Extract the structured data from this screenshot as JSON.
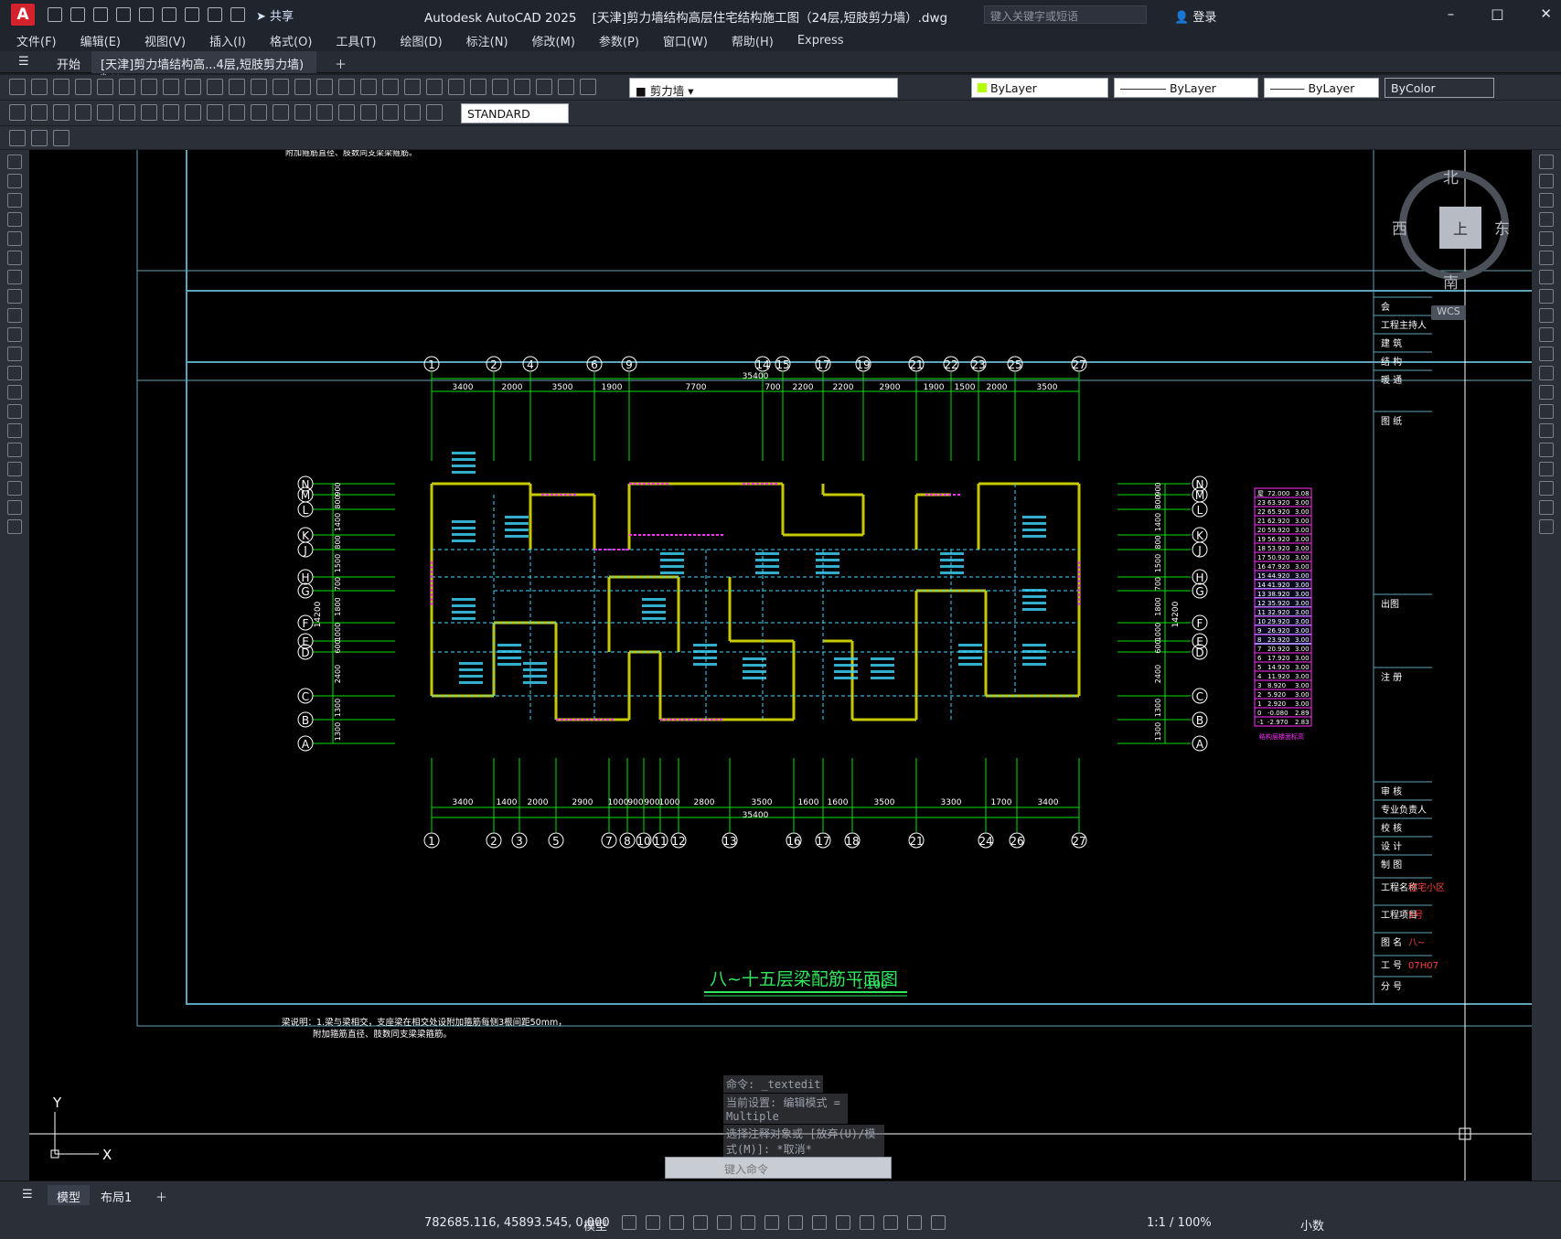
{
  "app": {
    "title": "Autodesk AutoCAD 2025",
    "document": "[天津]剪力墙结构高层住宅结构施工图（24层,短肢剪力墙）.dwg",
    "search_placeholder": "键入关键字或短语",
    "login": "登录",
    "share": "共享",
    "logo": "A"
  },
  "menu": [
    "文件(F)",
    "编辑(E)",
    "视图(V)",
    "插入(I)",
    "格式(O)",
    "工具(T)",
    "绘图(D)",
    "标注(N)",
    "修改(M)",
    "参数(P)",
    "窗口(W)",
    "帮助(H)",
    "Express"
  ],
  "tabs": {
    "start": "开始",
    "active": "[天津]剪力墙结构高...4层,短肢剪力墙)",
    "active_mark": "*"
  },
  "toolbar": {
    "layer": "剪力墙",
    "color": "ByLayer",
    "linetype": "ByLayer",
    "lineweight": "ByLayer",
    "plotstyle": "ByColor",
    "textstyle": "STANDARD"
  },
  "navcube": {
    "north": "北",
    "south": "南",
    "east": "东",
    "west": "西",
    "top": "上",
    "wcs": "WCS"
  },
  "drawing": {
    "top_note": "附加箍筋直径、肢数同支梁梁箍筋。",
    "plan_title": "八~十五层梁配筋平面图",
    "scale": "1:100",
    "notes_line1": "梁说明：1.梁与梁相交，支座梁在相交处设附加箍筋每侧3根间距50mm，",
    "notes_line2": "附加箍筋直径、肢数同支梁梁箍筋。",
    "top_axes": [
      "1",
      "2",
      "4",
      "6",
      "9",
      "14",
      "15",
      "17",
      "19",
      "21",
      "22",
      "23",
      "25",
      "27"
    ],
    "bottom_axes": [
      "1",
      "2",
      "3",
      "5",
      "7",
      "8",
      "10",
      "11",
      "12",
      "13",
      "16",
      "17",
      "18",
      "21",
      "24",
      "26",
      "27"
    ],
    "side_axes": [
      "N",
      "M",
      "L",
      "K",
      "J",
      "H",
      "G",
      "F",
      "E",
      "D",
      "C",
      "B",
      "A"
    ],
    "top_dims": [
      "3400",
      "2000",
      "3500",
      "1900",
      "7700",
      "700",
      "2200",
      "2200",
      "2900",
      "1900",
      "1500",
      "2000",
      "3500"
    ],
    "bottom_dims": [
      "3400",
      "1400",
      "2000",
      "2900",
      "1000",
      "900",
      "900",
      "1000",
      "2800",
      "3500",
      "1600",
      "1600",
      "3500",
      "3300",
      "1700",
      "3400"
    ],
    "total_dim": "35400",
    "side_dims": [
      "900",
      "800",
      "1400",
      "800",
      "1500",
      "700",
      "1800",
      "1000",
      "600",
      "2400",
      "1300",
      "1300"
    ],
    "side_total": "14200",
    "floor_table": [
      [
        "屋",
        "72.000",
        "3.08"
      ],
      [
        "23",
        "63.920",
        "3.00"
      ],
      [
        "22",
        "65.920",
        "3.00"
      ],
      [
        "21",
        "62.920",
        "3.00"
      ],
      [
        "20",
        "59.920",
        "3.00"
      ],
      [
        "19",
        "56.920",
        "3.00"
      ],
      [
        "18",
        "53.920",
        "3.00"
      ],
      [
        "17",
        "50.920",
        "3.00"
      ],
      [
        "16",
        "47.920",
        "3.00"
      ],
      [
        "15",
        "44.920",
        "3.00"
      ],
      [
        "14",
        "41.920",
        "3.00"
      ],
      [
        "13",
        "38.920",
        "3.00"
      ],
      [
        "12",
        "35.920",
        "3.00"
      ],
      [
        "11",
        "32.920",
        "3.00"
      ],
      [
        "10",
        "29.920",
        "3.00"
      ],
      [
        "9",
        "26.920",
        "3.00"
      ],
      [
        "8",
        "23.920",
        "3.00"
      ],
      [
        "7",
        "20.920",
        "3.00"
      ],
      [
        "6",
        "17.920",
        "3.00"
      ],
      [
        "5",
        "14.920",
        "3.00"
      ],
      [
        "4",
        "11.920",
        "3.00"
      ],
      [
        "3",
        "8.920",
        "3.00"
      ],
      [
        "2",
        "5.920",
        "3.00"
      ],
      [
        "1",
        "2.920",
        "3.00"
      ],
      [
        "0",
        "-0.080",
        "2.89"
      ],
      [
        "-1",
        "-2.970",
        "2.83"
      ]
    ],
    "floor_table_caption": "结构层楼面标高",
    "titleblock": [
      "会",
      "工程主持人",
      "建 筑",
      "结 构",
      "暖 通",
      "图 纸",
      "出图",
      "注 册",
      "审 核",
      "专业负责人",
      "校 核",
      "设 计",
      "制 图",
      "工程名称",
      "工程项目",
      "图 名",
      "工 号",
      "分 号"
    ],
    "titleblock_values": {
      "工程名称": "住宅小区",
      "工程项目": "5号",
      "图 名": "八~",
      "工 号": "07H07"
    },
    "command_history": [
      "命令: _textedit",
      "当前设置: 编辑模式 = Multiple",
      "选择注释对象或 [放弃(U)/模式(M)]: *取消*"
    ],
    "command_placeholder": "键入命令"
  },
  "layout_tabs": [
    "模型",
    "布局1"
  ],
  "status": {
    "coords": "782685.116, 45893.545, 0.000",
    "model": "模型",
    "scale": "1:1 / 100%",
    "units": "小数"
  }
}
